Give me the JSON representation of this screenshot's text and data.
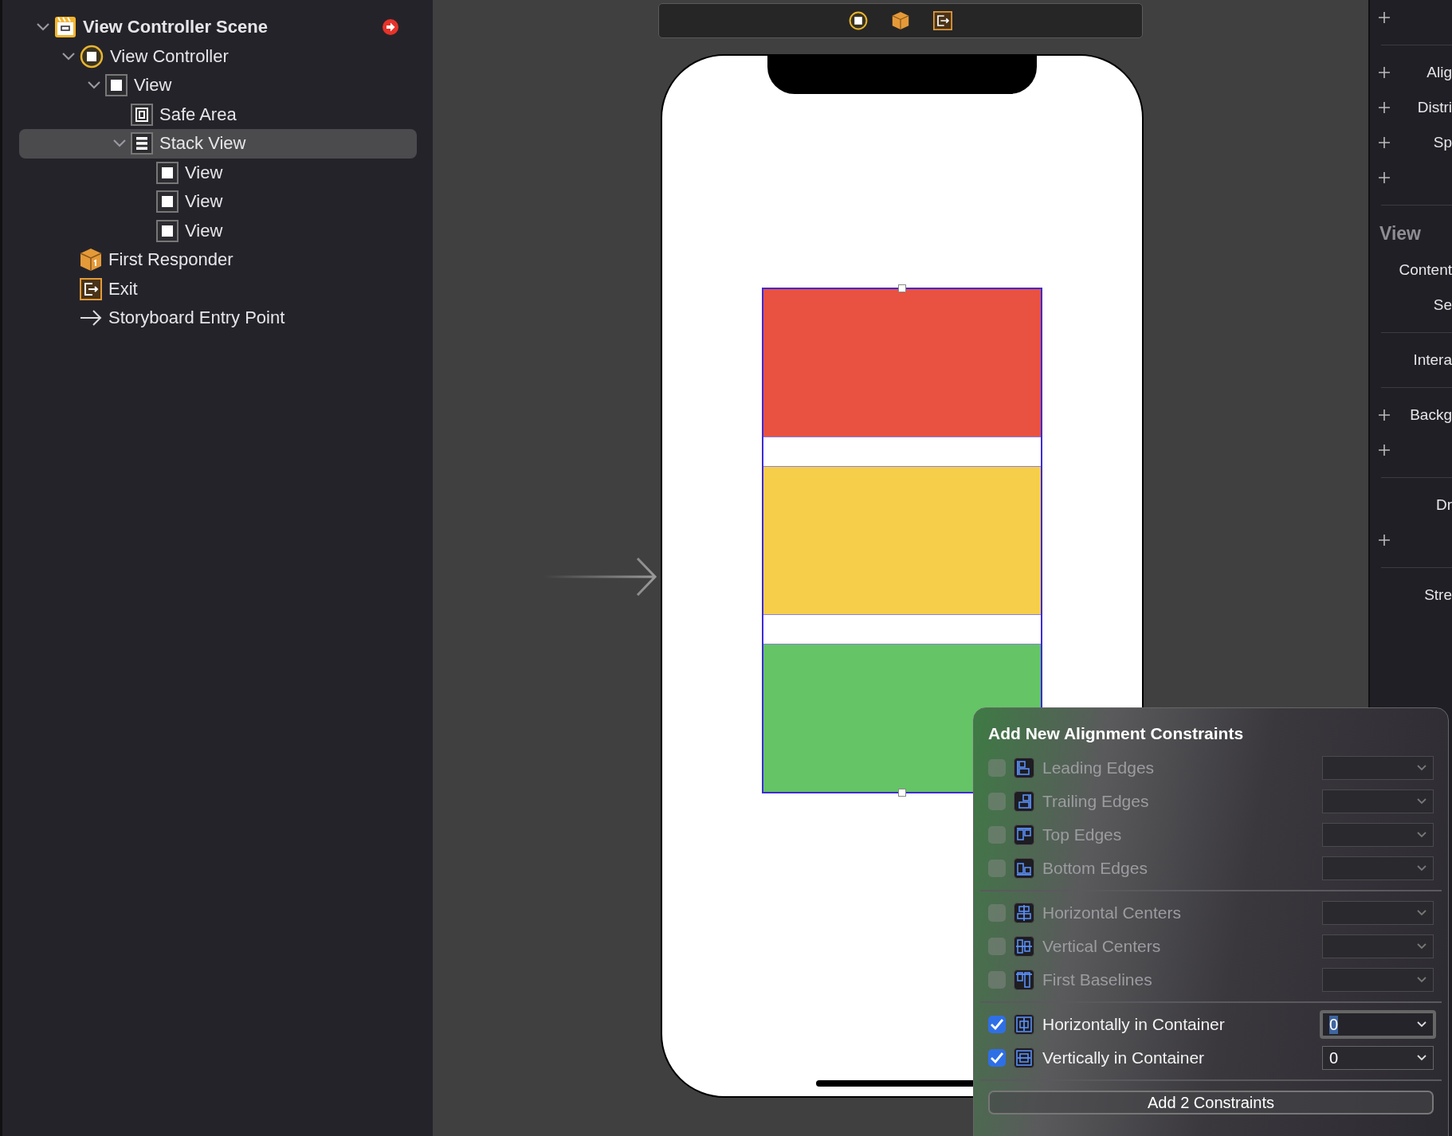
{
  "outline": {
    "items": [
      {
        "label": "View Controller Scene",
        "kind": "scene",
        "expanded": true,
        "selected": false,
        "children": [
          {
            "label": "View Controller",
            "kind": "controller",
            "expanded": true,
            "selected": false,
            "children": [
              {
                "label": "View",
                "kind": "view",
                "expanded": true,
                "selected": false,
                "children": [
                  {
                    "label": "Safe Area",
                    "kind": "safearea",
                    "selected": false
                  },
                  {
                    "label": "Stack View",
                    "kind": "stack",
                    "expanded": true,
                    "selected": true,
                    "children": [
                      {
                        "label": "View",
                        "kind": "view",
                        "selected": false
                      },
                      {
                        "label": "View",
                        "kind": "view",
                        "selected": false
                      },
                      {
                        "label": "View",
                        "kind": "view",
                        "selected": false
                      }
                    ]
                  }
                ]
              }
            ]
          },
          {
            "label": "First Responder",
            "kind": "responder",
            "selected": false
          },
          {
            "label": "Exit",
            "kind": "exit",
            "selected": false
          },
          {
            "label": "Storyboard Entry Point",
            "kind": "entry",
            "selected": false
          }
        ]
      }
    ]
  },
  "canvas": {
    "arranged_views": [
      {
        "color": "#e95140"
      },
      {
        "color": "#f6ce4a"
      },
      {
        "color": "#64c466"
      }
    ]
  },
  "inspector": {
    "rows": [
      {
        "kind": "row",
        "add": true
      },
      {
        "kind": "divider"
      },
      {
        "kind": "row",
        "add": true,
        "label": "Alig"
      },
      {
        "kind": "row",
        "add": true,
        "label": "Distri"
      },
      {
        "kind": "row",
        "add": true,
        "label": "Sp"
      },
      {
        "kind": "row",
        "add": true
      },
      {
        "kind": "divider"
      },
      {
        "kind": "header",
        "label": "View"
      },
      {
        "kind": "row",
        "add": false,
        "label": "Content"
      },
      {
        "kind": "row",
        "add": false,
        "label": "Se"
      },
      {
        "kind": "divider"
      },
      {
        "kind": "row",
        "add": false,
        "label": "Intera"
      },
      {
        "kind": "divider"
      },
      {
        "kind": "row",
        "add": true,
        "label": "Backg"
      },
      {
        "kind": "row",
        "add": true
      },
      {
        "kind": "divider"
      },
      {
        "kind": "row",
        "add": false,
        "label": "Dr"
      },
      {
        "kind": "row",
        "add": true
      },
      {
        "kind": "divider"
      },
      {
        "kind": "row",
        "add": false,
        "label": "Stre"
      }
    ]
  },
  "popover": {
    "title": "Add New Alignment Constraints",
    "groups": [
      [
        {
          "label": "Leading Edges",
          "checked": false,
          "focused": false
        },
        {
          "label": "Trailing Edges",
          "checked": false,
          "focused": false
        },
        {
          "label": "Top Edges",
          "checked": false,
          "focused": false
        },
        {
          "label": "Bottom Edges",
          "checked": false,
          "focused": false
        }
      ],
      [
        {
          "label": "Horizontal Centers",
          "checked": false,
          "focused": false
        },
        {
          "label": "Vertical Centers",
          "checked": false,
          "focused": false
        },
        {
          "label": "First Baselines",
          "checked": false,
          "focused": false
        }
      ],
      [
        {
          "label": "Horizontally in Container",
          "checked": true,
          "focused": true,
          "value": "0"
        },
        {
          "label": "Vertically in Container",
          "checked": true,
          "focused": false,
          "value": "0"
        }
      ]
    ],
    "button": "Add 2 Constraints"
  }
}
